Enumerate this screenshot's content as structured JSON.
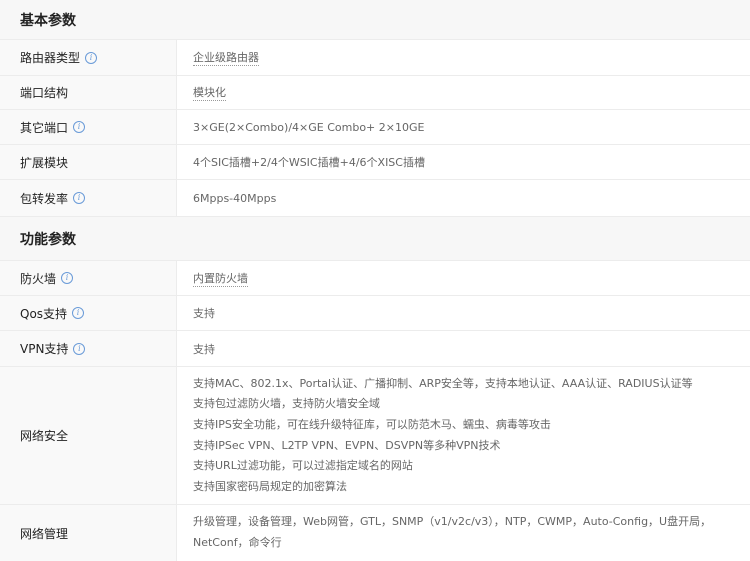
{
  "sections": [
    {
      "title": "基本参数",
      "rows": [
        {
          "label": "路由器类型",
          "value": "企业级路由器",
          "info": true,
          "link": true
        },
        {
          "label": "端口结构",
          "value": "模块化",
          "info": false,
          "link": true
        },
        {
          "label": "其它端口",
          "value": "3×GE(2×Combo)/4×GE Combo+ 2×10GE",
          "info": true
        },
        {
          "label": "扩展模块",
          "value": "4个SIC插槽+2/4个WSIC插槽+4/6个XISC插槽",
          "info": false
        },
        {
          "label": "包转发率",
          "value": "6Mpps-40Mpps",
          "info": true
        }
      ]
    },
    {
      "title": "功能参数",
      "rows": [
        {
          "label": "防火墙",
          "value": "内置防火墙",
          "info": true,
          "link": true
        },
        {
          "label": "Qos支持",
          "value": "支持",
          "info": true
        },
        {
          "label": "VPN支持",
          "value": "支持",
          "info": true
        },
        {
          "label": "网络安全",
          "lines": [
            "支持MAC、802.1x、Portal认证、广播抑制、ARP安全等，支持本地认证、AAA认证、RADIUS认证等",
            "支持包过滤防火墙，支持防火墙安全域",
            "支持IPS安全功能，可在线升级特征库，可以防范木马、蠕虫、病毒等攻击",
            "支持IPSec VPN、L2TP VPN、EVPN、DSVPN等多种VPN技术",
            "支持URL过滤功能，可以过滤指定域名的网站",
            "支持国家密码局规定的加密算法"
          ]
        },
        {
          "label": "网络管理",
          "value": "升级管理，设备管理，Web网管，GTL，SNMP（v1/v2c/v3），NTP，CWMP，Auto-Config，U盘开局，NetConf，命令行"
        }
      ]
    }
  ]
}
